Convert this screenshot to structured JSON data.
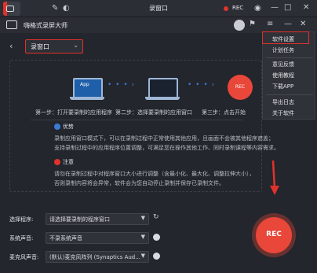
{
  "os_bar": {
    "title": "录窗口",
    "rec_label": "REC"
  },
  "app": {
    "name": "嗨格式录屏大师"
  },
  "toolbar": {
    "mode": "录窗口"
  },
  "steps": [
    {
      "label": "第一步：打开要录制的应用程序",
      "app_label": "App"
    },
    {
      "label": "第二步：选择要录制的应用窗口"
    },
    {
      "label": "第三步：点击开始",
      "button_label": "REC"
    }
  ],
  "advantage": {
    "title": "优势",
    "lines": [
      "录制应用窗口模式下，可以在录制过程中正常使用其他应用，且画面不会被其他程序遮盖；",
      "支持录制过程中的应用程序位置调整，可满足您在操作其他工作、同时录制课程等内容需求。"
    ]
  },
  "notice": {
    "title": "注意",
    "lines": [
      "请勿在录制过程中对程序窗口大小进行调整（含最小化、最大化、调整拉伸大小），",
      "否则录制内容将会异常，软件会为您自动停止录制并保存已录制文件。"
    ]
  },
  "form": {
    "program_label": "选择程序:",
    "program_value": "请选择要录制的程序窗口",
    "system_audio_label": "系统声音:",
    "system_audio_value": "不录系统声音",
    "mic_label": "麦克风声音:",
    "mic_value": "(默认)麦克风阵列 (Synaptics Aud..."
  },
  "rec_button": {
    "label": "REC"
  },
  "menu": {
    "items": [
      "软件设置",
      "计划任务",
      "意见反馈",
      "使用教程",
      "下载APP",
      "导出日志",
      "关于软件"
    ]
  },
  "colors": {
    "accent": "#e0322c",
    "blue": "#3a7bd5",
    "bg": "#23262c"
  }
}
